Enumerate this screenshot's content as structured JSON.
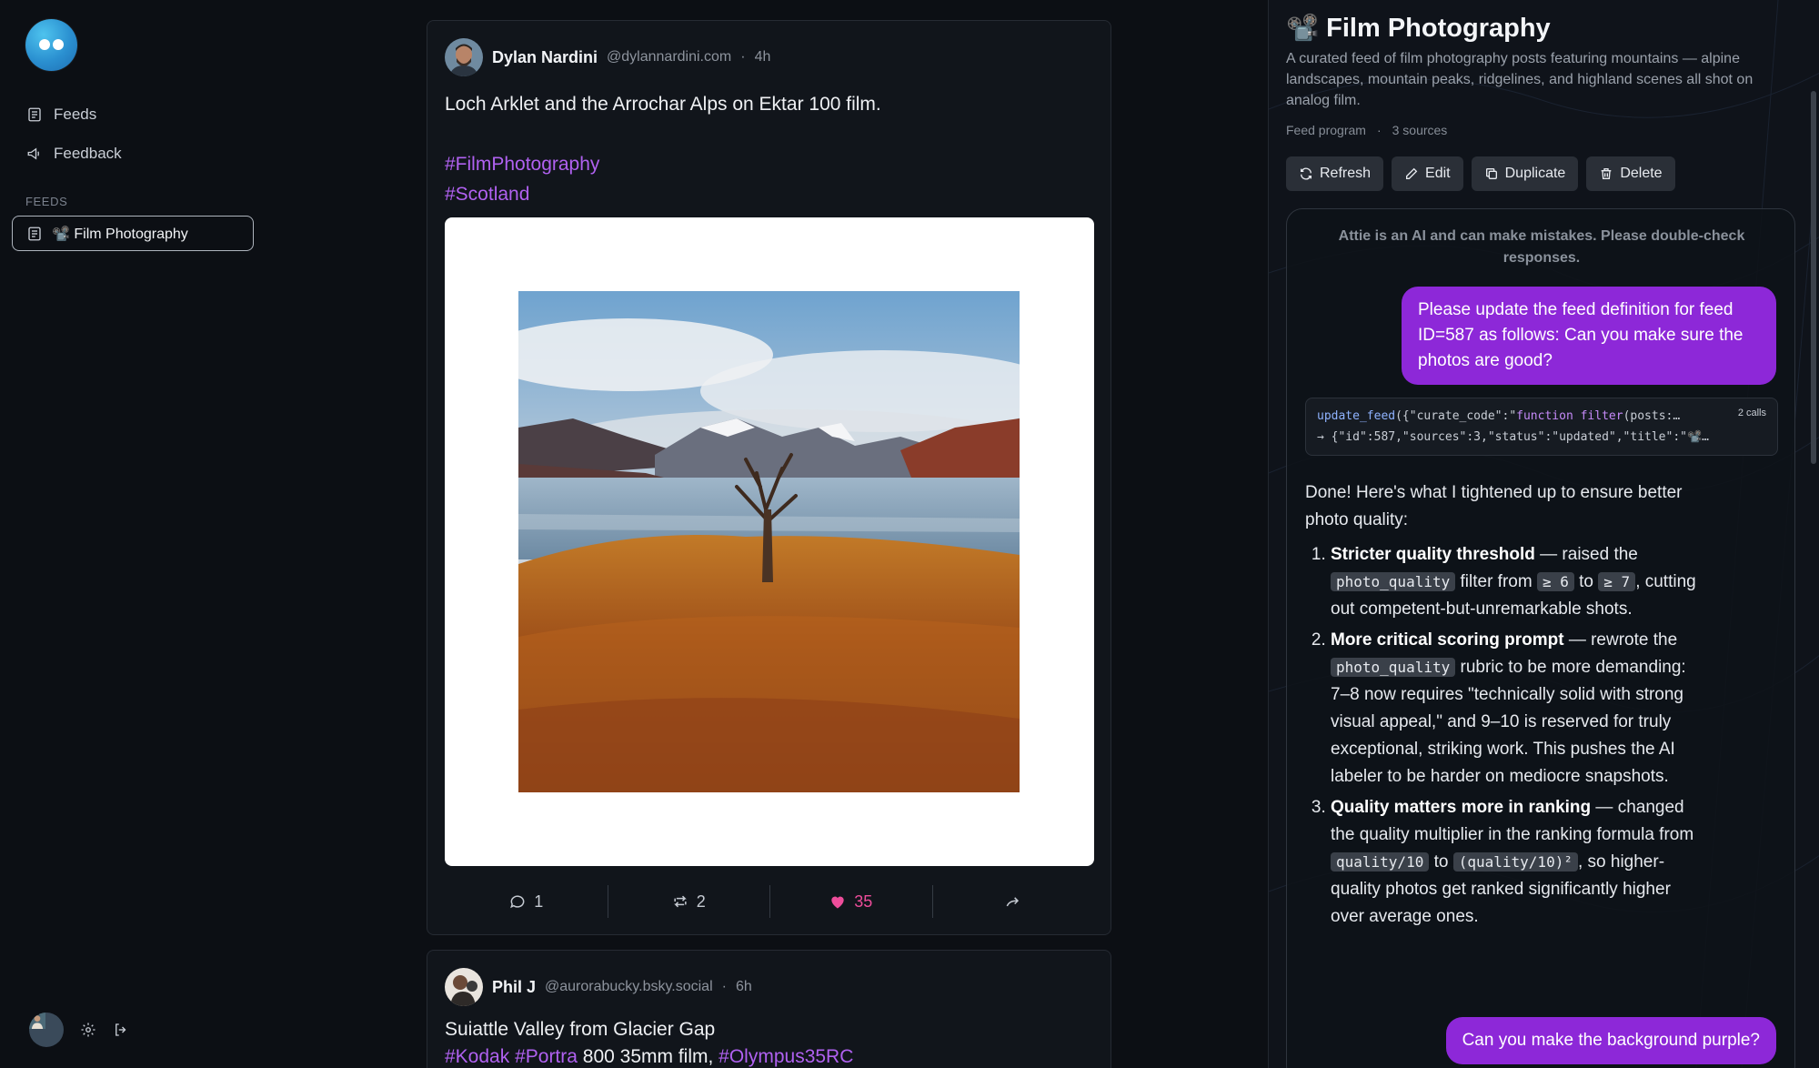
{
  "sidebar": {
    "nav": [
      {
        "label": "Feeds"
      },
      {
        "label": "Feedback"
      }
    ],
    "section_label": "FEEDS",
    "active_feed": "📽️ Film Photography"
  },
  "posts": [
    {
      "author": "Dylan Nardini",
      "handle": "@dylannardini.com",
      "sep": "·",
      "time": "4h",
      "text": "Loch Arklet and the Arrochar Alps on Ektar 100 film.",
      "tags": [
        "#FilmPhotography",
        "#Scotland"
      ],
      "comments": "1",
      "reposts": "2",
      "likes": "35"
    },
    {
      "author": "Phil J",
      "handle": "@aurorabucky.bsky.social",
      "sep": "·",
      "time": "6h",
      "text": "Suiattle Valley from Glacier Gap",
      "tag1": "#Kodak",
      "tag2": "#Portra",
      "mid": " 800 35mm film, ",
      "tag3": "#Olympus35RC"
    }
  ],
  "panel": {
    "title": "📽️ Film Photography",
    "description": "A curated feed of film photography posts featuring mountains — alpine landscapes, mountain peaks, ridgelines, and highland scenes all shot on analog film.",
    "meta_type": "Feed program",
    "meta_sep": "·",
    "meta_sources": "3 sources",
    "buttons": {
      "refresh": "Refresh",
      "edit": "Edit",
      "duplicate": "Duplicate",
      "delete": "Delete"
    },
    "disclaimer": "Attie is an AI and can make mistakes. Please double-check responses.",
    "user_message_1": "Please update the feed definition for feed ID=587 as follows: Can you make sure the photos are good?",
    "tool_call": {
      "fn": "update_feed",
      "args": "({\"curate_code\":\"",
      "kw": "function filter",
      "rest": "(posts:…",
      "result": "→ {\"id\":587,\"sources\":3,\"status\":\"updated\",\"title\":\"📽️…",
      "calls": "2 calls"
    },
    "reply": {
      "intro": "Done! Here's what I tightened up to ensure better photo quality:",
      "item1_title": "Stricter quality threshold",
      "item1_a": " — raised the ",
      "item1_code1": "photo_quality",
      "item1_b": " filter from ",
      "item1_code2": "≥ 6",
      "item1_c": " to ",
      "item1_code3": "≥ 7",
      "item1_d": ", cutting out competent-but-unremarkable shots.",
      "item2_title": "More critical scoring prompt",
      "item2_a": " — rewrote the ",
      "item2_code1": "photo_quality",
      "item2_b": " rubric to be more demanding: 7–8 now requires \"technically solid with strong visual appeal,\" and 9–10 is reserved for truly exceptional, striking work. This pushes the AI labeler to be harder on mediocre snapshots.",
      "item3_title": "Quality matters more in ranking",
      "item3_a": " — changed the quality multiplier in the ranking formula from ",
      "item3_code1": "quality/10",
      "item3_b": " to ",
      "item3_code2": "(quality/10)²",
      "item3_c": ", so higher-quality photos get ranked significantly higher over average ones."
    },
    "user_message_2": "Can you make the background purple?"
  },
  "colors": {
    "accent": "#8d28d8",
    "hashtag": "#b061f0",
    "like": "#ee4d9b",
    "background": "#0c0f14"
  }
}
